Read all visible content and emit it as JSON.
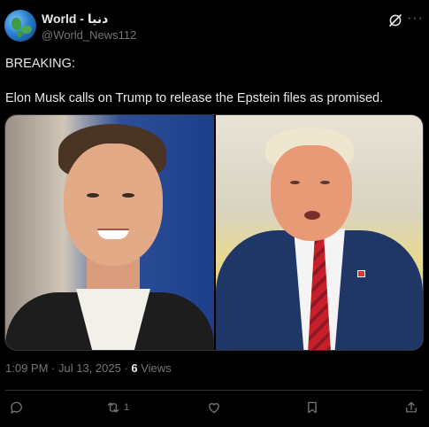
{
  "author": {
    "display_name": "World - دنيا",
    "handle": "@World_News112",
    "avatar_icon": "globe-avatar"
  },
  "header_icons": [
    "grok-icon",
    "more-icon"
  ],
  "more_glyph": "···",
  "tweet": {
    "line1": "BREAKING:",
    "line2": "Elon Musk calls on Trump to release the Epstein files as promised."
  },
  "media": {
    "image_count": 2
  },
  "meta": {
    "time": "1:09 PM",
    "separator": " · ",
    "date": "Jul 13, 2025",
    "dot": " · ",
    "views_count": "6",
    "views_label": " Views"
  },
  "actions": {
    "reply": {
      "icon": "reply-icon",
      "count": ""
    },
    "repost": {
      "icon": "repost-icon",
      "count": "1"
    },
    "like": {
      "icon": "heart-icon",
      "count": ""
    },
    "bookmark": {
      "icon": "bookmark-icon",
      "count": ""
    },
    "share": {
      "icon": "share-icon",
      "count": ""
    }
  },
  "colors": {
    "background": "#000000",
    "text": "#e7e9ea",
    "muted": "#71767b",
    "border": "#2f3336"
  }
}
